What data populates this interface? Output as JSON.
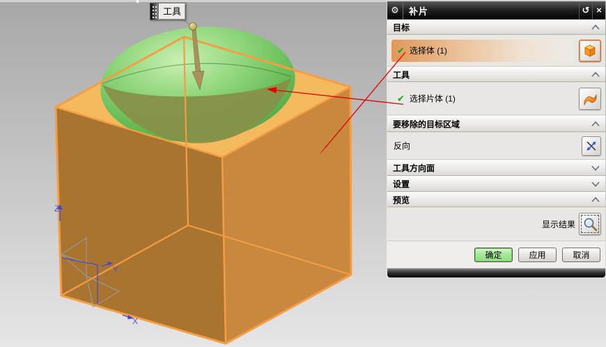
{
  "toolbar": {
    "label": "工具"
  },
  "dialog": {
    "title": "补片",
    "titlebar": {
      "gear_icon": "⚙",
      "reset_icon": "↺",
      "close_icon": "×"
    },
    "sections": {
      "target": {
        "label": "目标",
        "row_label": "选择体 (1)",
        "check": "✔",
        "collapsed": false
      },
      "tool": {
        "label": "工具",
        "row_label": "选择片体 (1)",
        "check": "✔",
        "collapsed": false
      },
      "remove_region": {
        "label": "要移除的目标区域",
        "row_label": "反向",
        "collapsed": false
      },
      "tool_direction": {
        "label": "工具方向面",
        "collapsed": true
      },
      "settings": {
        "label": "设置",
        "collapsed": true
      },
      "preview": {
        "label": "预览",
        "show_result_label": "显示结果",
        "collapsed": false
      }
    },
    "footer": {
      "ok": "确定",
      "apply": "应用",
      "cancel": "取消"
    }
  },
  "viewport": {
    "axes": {
      "z": "Z",
      "y": "Y",
      "x": "X"
    }
  },
  "colors": {
    "selection_edge_orange": "#f59d43",
    "cube_left_face": "#a9742f",
    "cube_right_face": "#c8893f",
    "cube_top_face": "#f6ba5e",
    "dome_green": "#7cc868",
    "dome_under_glass": "#6e8f4a",
    "leader_red": "#e00000",
    "row_highlight_orange": "#e0985a",
    "ok_button_green": "#8ede7e",
    "handle_tan": "#a7925a",
    "axis_blue": "#5050cc",
    "titlebar_dark": "#1c1c1c"
  }
}
